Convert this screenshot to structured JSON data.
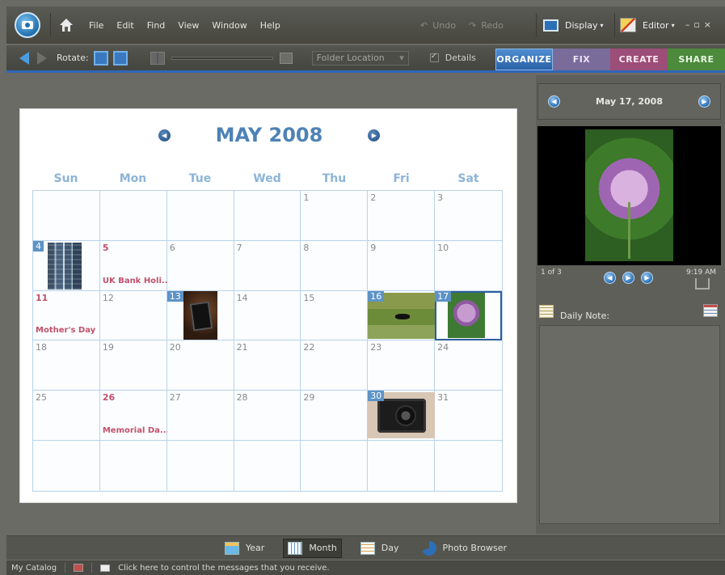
{
  "menubar": {
    "items": [
      "File",
      "Edit",
      "Find",
      "View",
      "Window",
      "Help"
    ],
    "undo": "Undo",
    "redo": "Redo",
    "display": "Display",
    "editor": "Editor"
  },
  "toolbar": {
    "rotate_label": "Rotate:",
    "folder_location": "Folder Location",
    "details_label": "Details",
    "details_checked": true,
    "tabs": [
      "ORGANIZE",
      "FIX",
      "CREATE",
      "SHARE"
    ],
    "active_tab": "ORGANIZE"
  },
  "calendar": {
    "month_title": "MAY 2008",
    "weekdays": [
      "Sun",
      "Mon",
      "Tue",
      "Wed",
      "Thu",
      "Fri",
      "Sat"
    ],
    "cells": [
      {
        "day": ""
      },
      {
        "day": ""
      },
      {
        "day": ""
      },
      {
        "day": ""
      },
      {
        "day": "1"
      },
      {
        "day": "2"
      },
      {
        "day": "3"
      },
      {
        "day": "4",
        "photo": "building"
      },
      {
        "day": "5",
        "holiday": true,
        "event": "UK Bank Holi..."
      },
      {
        "day": "6"
      },
      {
        "day": "7"
      },
      {
        "day": "8"
      },
      {
        "day": "9"
      },
      {
        "day": "10"
      },
      {
        "day": "11",
        "holiday": true,
        "event": "Mother's Day"
      },
      {
        "day": "12"
      },
      {
        "day": "13",
        "photo": "phone"
      },
      {
        "day": "14"
      },
      {
        "day": "15"
      },
      {
        "day": "16",
        "photo": "dog"
      },
      {
        "day": "17",
        "photo": "flower",
        "selected": true
      },
      {
        "day": "18"
      },
      {
        "day": "19"
      },
      {
        "day": "20"
      },
      {
        "day": "21"
      },
      {
        "day": "22"
      },
      {
        "day": "23"
      },
      {
        "day": "24"
      },
      {
        "day": "25"
      },
      {
        "day": "26",
        "holiday": true,
        "event": "Memorial Da..."
      },
      {
        "day": "27"
      },
      {
        "day": "28"
      },
      {
        "day": "29"
      },
      {
        "day": "30",
        "photo": "camera"
      },
      {
        "day": "31"
      },
      {
        "day": ""
      },
      {
        "day": ""
      },
      {
        "day": ""
      },
      {
        "day": ""
      },
      {
        "day": ""
      },
      {
        "day": ""
      },
      {
        "day": ""
      }
    ]
  },
  "sidepanel": {
    "date_label": "May 17, 2008",
    "photo_count": "1 of 3",
    "photo_time": "9:19 AM",
    "daily_note_label": "Daily Note:"
  },
  "viewbar": {
    "buttons": [
      "Year",
      "Month",
      "Day",
      "Photo Browser"
    ],
    "active": "Month"
  },
  "statusbar": {
    "catalog": "My Catalog",
    "message": "Click here to control the messages that you receive."
  }
}
